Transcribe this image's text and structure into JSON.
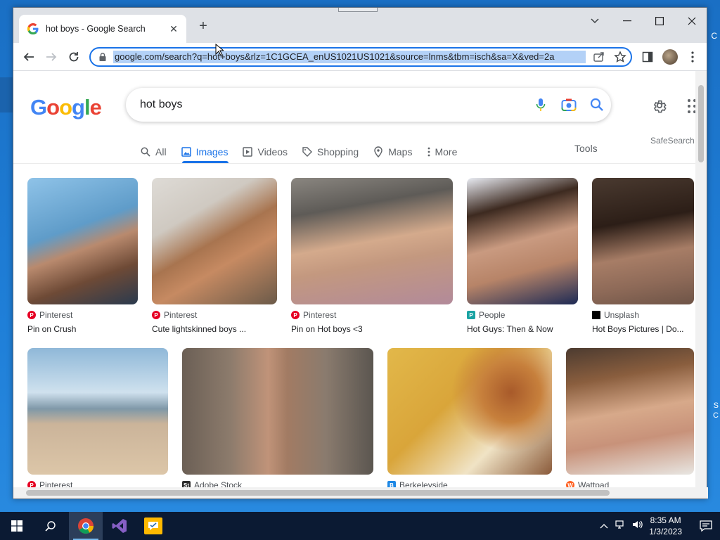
{
  "browser": {
    "tab": {
      "title": "hot boys - Google Search",
      "favicon": "google-favicon"
    },
    "omnibox": {
      "url": "google.com/search?q=hot+boys&rlz=1C1GCEA_enUS1021US1021&source=lnms&tbm=isch&sa=X&ved=2a"
    }
  },
  "search": {
    "query": "hot boys",
    "tabs": [
      {
        "label": "All",
        "icon": "search-icon"
      },
      {
        "label": "Images",
        "icon": "image-icon"
      },
      {
        "label": "Videos",
        "icon": "video-icon"
      },
      {
        "label": "Shopping",
        "icon": "tag-icon"
      },
      {
        "label": "Maps",
        "icon": "pin-icon"
      },
      {
        "label": "More",
        "icon": "more-vert-icon"
      }
    ],
    "active_tab": "Images",
    "tools_label": "Tools",
    "safesearch_label": "SafeSearch"
  },
  "results": [
    {
      "source": "Pinterest",
      "caption": "Pin on Crush",
      "source_color": "#e60023"
    },
    {
      "source": "Pinterest",
      "caption": "Cute lightskinned boys ...",
      "source_color": "#e60023"
    },
    {
      "source": "Pinterest",
      "caption": "Pin on Hot boys <3",
      "source_color": "#e60023"
    },
    {
      "source": "People",
      "caption": "Hot Guys: Then & Now",
      "source_color": "#1aa3a3"
    },
    {
      "source": "Unsplash",
      "caption": "Hot Boys Pictures | Do...",
      "source_color": "#000000"
    },
    {
      "source": "Pinterest",
      "caption": "",
      "source_color": "#e60023"
    },
    {
      "source": "Adobe Stock",
      "caption": "",
      "source_color": "#2b2b2b"
    },
    {
      "source": "Berkeleyside",
      "caption": "",
      "source_color": "#1e88e5"
    },
    {
      "source": "Wattpad",
      "caption": "",
      "source_color": "#ff6122"
    }
  ],
  "taskbar": {
    "time": "8:35 AM",
    "date": "1/3/2023"
  },
  "desktop_edge": {
    "top_char": "C",
    "right_chars": [
      "S",
      "C"
    ]
  }
}
